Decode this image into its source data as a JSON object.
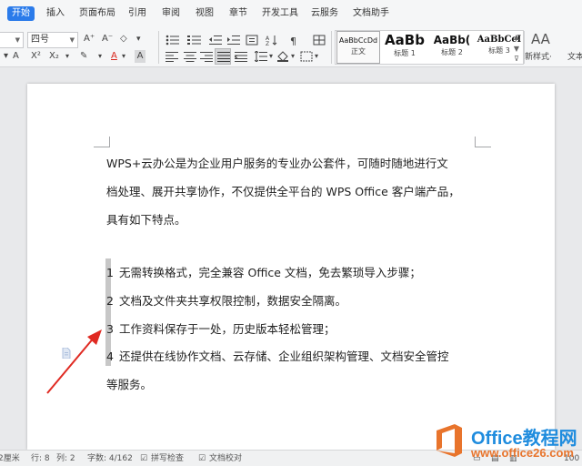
{
  "menu": {
    "tabs": [
      "开始",
      "插入",
      "页面布局",
      "引用",
      "审阅",
      "视图",
      "章节",
      "开发工具",
      "云服务",
      "文档助手"
    ]
  },
  "toolbar": {
    "font_name_value": "",
    "font_size_value": "四号",
    "grow_font_label": "A⁺",
    "shrink_font_label": "A⁻",
    "clear_format_label": "◇",
    "superscript_label": "X²",
    "subscript_label": "X₂",
    "font_color_label": "A",
    "char_shading_label": "A",
    "font_color": "#d9261c"
  },
  "styles": {
    "gallery": [
      {
        "preview": "AaBbCcDd",
        "name": "正文",
        "selected": true
      },
      {
        "preview": "AaBb",
        "name": "标题 1"
      },
      {
        "preview": "AaBb(",
        "name": "标题 2"
      },
      {
        "preview": "AaBbCcI",
        "name": "标题 3"
      }
    ],
    "new_style_icon": "AA",
    "new_style_label": "新样式·",
    "overflow_label": "文本"
  },
  "document": {
    "intro_lines": [
      "WPS+云办公是为企业用户服务的专业办公套件，可随时随地进行文",
      "档处理、展开共享协作，不仅提供全平台的 WPS Office 客户端产品，",
      "具有如下特点。"
    ],
    "list_items": [
      {
        "num": "1",
        "text": "无需转换格式，完全兼容 Office 文档，免去繁琐导入步骤；"
      },
      {
        "num": "2",
        "text": "文档及文件夹共享权限控制，数据安全隔离。"
      },
      {
        "num": "3",
        "text": "工作资料保存于一处，历史版本轻松管理；"
      },
      {
        "num": "4",
        "text": "还提供在线协作文档、云存储、企业组织架构管理、文档安全管控"
      }
    ],
    "list_continuation": "等服务。",
    "annotation_arrow_color": "#e02a22"
  },
  "statusbar": {
    "position": "2厘米",
    "row": "行: 8",
    "col": "列: 2",
    "word_count": "字数: 4/162",
    "spell_check": "拼写检查",
    "doc_proof": "文档校对",
    "zoom": "100"
  },
  "watermark": {
    "title": "Office教程网",
    "url": "www.office26.com"
  },
  "colors": {
    "accent": "#2b7bea",
    "watermark_blue": "#1f8cde",
    "watermark_orange": "#e8742c"
  }
}
